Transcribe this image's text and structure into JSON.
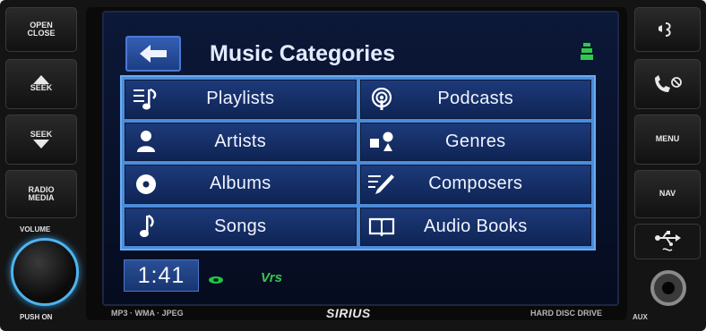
{
  "screen": {
    "title": "Music Categories",
    "clock": "1:41",
    "vrs_label": "Vrs",
    "accent": "#4c8cd8",
    "text_color": "#f0f4ff"
  },
  "categories": [
    {
      "label": "Playlists",
      "icon": "playlist-icon"
    },
    {
      "label": "Podcasts",
      "icon": "podcast-icon"
    },
    {
      "label": "Artists",
      "icon": "artist-icon"
    },
    {
      "label": "Genres",
      "icon": "genre-shapes-icon"
    },
    {
      "label": "Albums",
      "icon": "disc-icon"
    },
    {
      "label": "Composers",
      "icon": "composer-pen-icon"
    },
    {
      "label": "Songs",
      "icon": "music-note-icon"
    },
    {
      "label": "Audio Books",
      "icon": "open-book-icon"
    }
  ],
  "left_buttons": {
    "open_close": "OPEN CLOSE",
    "seek_up": "SEEK",
    "seek_down": "SEEK",
    "radio_media": "RADIO MEDIA",
    "volume": "VOLUME",
    "push_on": "PUSH ON"
  },
  "right_buttons": {
    "menu": "MENU",
    "nav": "NAV",
    "aux": "AUX"
  },
  "bottom_strip": {
    "left": "MP3 · WMA · JPEG",
    "center": "SIRIUS",
    "right": "HARD DISC DRIVE"
  }
}
